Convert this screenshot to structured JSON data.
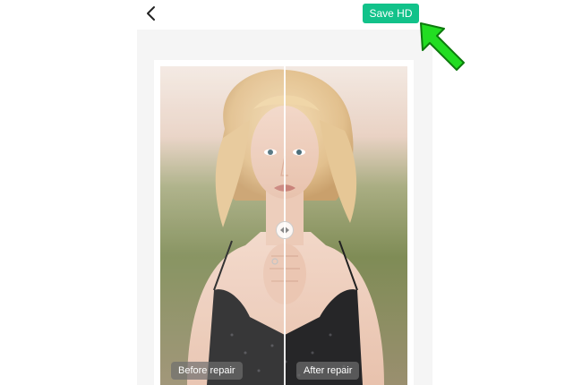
{
  "header": {
    "back_icon": "chevron-left-icon",
    "save_label": "Save HD"
  },
  "preview": {
    "before_label": "Before repair",
    "after_label": "After repair",
    "handle_icon": "split-handle-icon"
  },
  "colors": {
    "accent": "#12c28a",
    "pointer": "#22dd22"
  }
}
